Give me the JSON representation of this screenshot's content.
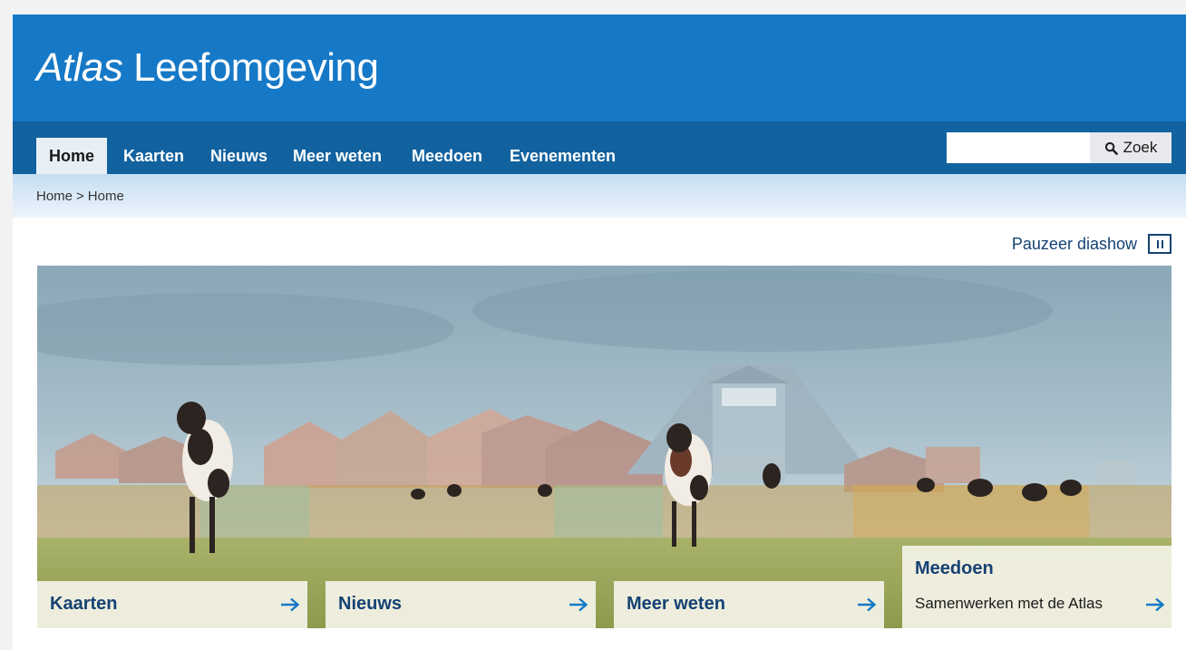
{
  "header": {
    "title_italic": "Atlas",
    "title_rest": "Leefomgeving"
  },
  "nav": {
    "items": [
      {
        "label": "Home",
        "active": true
      },
      {
        "label": "Kaarten"
      },
      {
        "label": "Nieuws"
      },
      {
        "label": "Meer weten"
      },
      {
        "label": "Meedoen"
      },
      {
        "label": "Evenementen"
      }
    ],
    "search": {
      "placeholder": "",
      "button_label": "Zoek",
      "icon": "search-icon"
    }
  },
  "breadcrumb": {
    "items": [
      "Home",
      "Home"
    ],
    "separator": ">"
  },
  "slideshow": {
    "pause_label": "Pauzeer diashow",
    "pause_icon": "pause-icon",
    "image_description_icon": "hero-image"
  },
  "tiles": [
    {
      "title": "Kaarten",
      "icon": "arrow-right-icon"
    },
    {
      "title": "Nieuws",
      "icon": "arrow-right-icon"
    },
    {
      "title": "Meer weten",
      "icon": "arrow-right-icon"
    },
    {
      "title": "Meedoen",
      "subtitle": "Samenwerken met de Atlas",
      "icon": "arrow-right-icon"
    }
  ],
  "colors": {
    "header": "#1679c7",
    "nav": "#12629f",
    "link": "#154273",
    "tile": "#f1efe2"
  }
}
